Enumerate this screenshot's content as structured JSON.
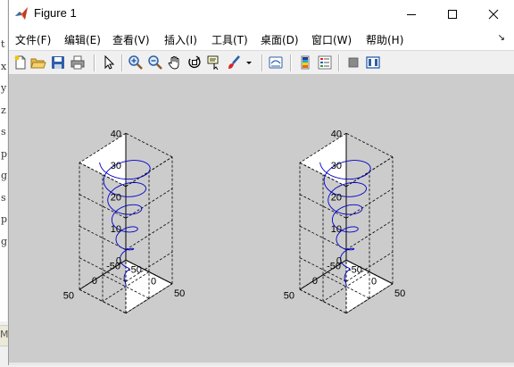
{
  "background_window": {
    "letters": [
      "t",
      "x",
      "y",
      "z",
      "s",
      "p",
      "g",
      "s",
      "p",
      "g"
    ],
    "status_fragment": "M"
  },
  "window": {
    "title": "Figure 1",
    "controls": [
      "minimize",
      "maximize",
      "close"
    ]
  },
  "menu": {
    "items": [
      {
        "label": "文件(F)"
      },
      {
        "label": "编辑(E)"
      },
      {
        "label": "查看(V)"
      },
      {
        "label": "插入(I)"
      },
      {
        "label": "工具(T)"
      },
      {
        "label": "桌面(D)"
      },
      {
        "label": "窗口(W)"
      },
      {
        "label": "帮助(H)"
      }
    ],
    "overflow_arrow": "↘"
  },
  "toolbar": {
    "buttons": [
      "new-figure",
      "open-file",
      "save-figure",
      "print-figure",
      "edit-plot",
      "zoom-in",
      "zoom-out",
      "pan",
      "rotate-3d",
      "data-cursor",
      "brush",
      "brush-dropdown",
      "link-plot",
      "colorbar",
      "legend",
      "hide-plot-tools",
      "show-plot-tools"
    ]
  },
  "colors": {
    "canvas": "#cccccc",
    "axes_bg": "#ffffff",
    "curve": "#0000c8",
    "grid": "#000000"
  },
  "chart_data": [
    {
      "type": "line3d",
      "series": [
        {
          "x_fn": "t*cos(t)",
          "y_fn": "t*sin(t)",
          "z_fn": "t",
          "t_range": [
            0,
            40
          ]
        }
      ],
      "xlim": [
        -50,
        50
      ],
      "ylim": [
        -50,
        50
      ],
      "zlim": [
        0,
        40
      ],
      "x_ticks": [
        "-50",
        "0",
        "50"
      ],
      "y_ticks": [
        "-50",
        "0",
        "50"
      ],
      "z_ticks": [
        "0",
        "10",
        "20",
        "30",
        "40"
      ],
      "grid": true
    },
    {
      "type": "line3d",
      "series": [
        {
          "x_fn": "t*cos(t)",
          "y_fn": "t*sin(t)",
          "z_fn": "t",
          "t_range": [
            0,
            40
          ]
        }
      ],
      "xlim": [
        -50,
        50
      ],
      "ylim": [
        -50,
        50
      ],
      "zlim": [
        0,
        40
      ],
      "x_ticks": [
        "-50",
        "0",
        "50"
      ],
      "y_ticks": [
        "-50",
        "0",
        "50"
      ],
      "z_ticks": [
        "0",
        "10",
        "20",
        "30",
        "40"
      ],
      "grid": true
    }
  ]
}
